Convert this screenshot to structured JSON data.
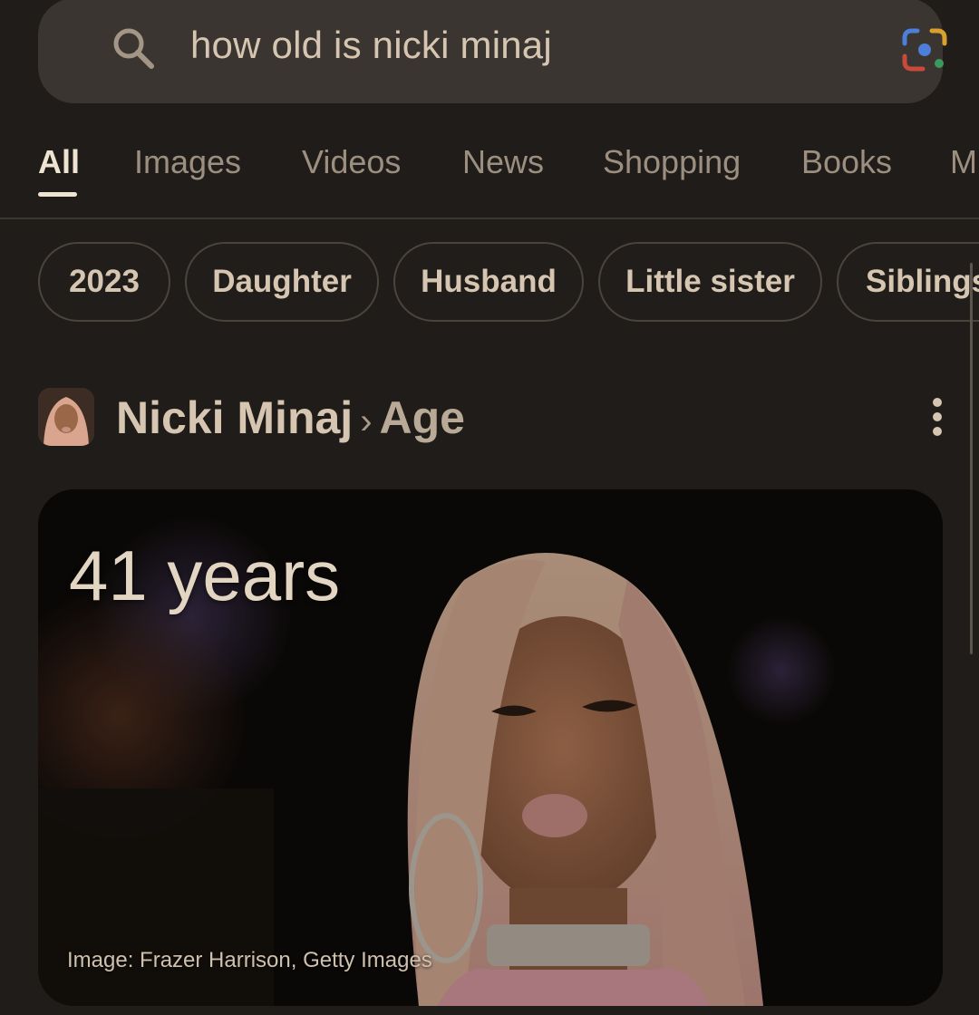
{
  "search": {
    "query": "how old is nicki minaj",
    "icon": "search-icon",
    "lens_icon": "google-lens-icon"
  },
  "tabs": [
    {
      "label": "All",
      "active": true
    },
    {
      "label": "Images"
    },
    {
      "label": "Videos"
    },
    {
      "label": "News"
    },
    {
      "label": "Shopping"
    },
    {
      "label": "Books"
    },
    {
      "label": "M"
    }
  ],
  "chips": [
    "2023",
    "Daughter",
    "Husband",
    "Little sister",
    "Siblings"
  ],
  "entity": {
    "name": "Nicki Minaj",
    "separator": "›",
    "attribute": "Age",
    "more_icon": "more-vert-icon"
  },
  "answer": {
    "value": "41 years",
    "image_credit": "Image: Frazer Harrison, Getty Images"
  },
  "colors": {
    "background": "#1f1c19",
    "search_bar": "#3a3530",
    "text_primary": "#d6c6b1",
    "text_muted": "#9c8f80"
  }
}
